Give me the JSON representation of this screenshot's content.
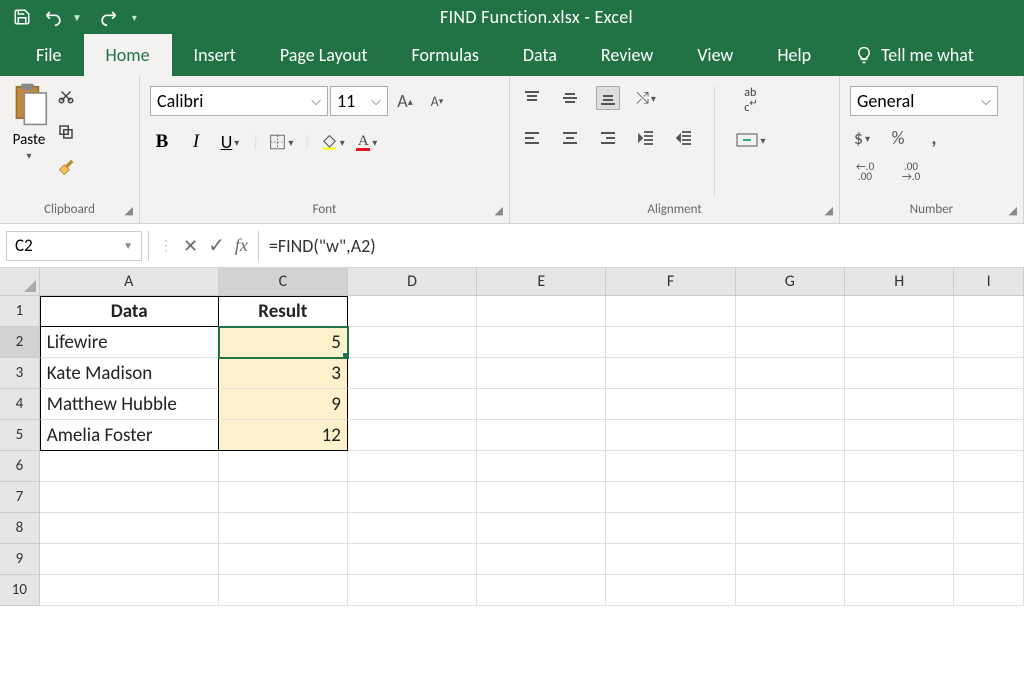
{
  "titlebar": {
    "title": "FIND Function.xlsx  -  Excel"
  },
  "tabs": {
    "file": "File",
    "home": "Home",
    "insert": "Insert",
    "pagelayout": "Page Layout",
    "formulas": "Formulas",
    "data": "Data",
    "review": "Review",
    "view": "View",
    "help": "Help",
    "tellme": "Tell me what"
  },
  "ribbon": {
    "clipboard": {
      "paste": "Paste",
      "label": "Clipboard"
    },
    "font": {
      "name": "Calibri",
      "size": "11",
      "label": "Font",
      "bold": "B",
      "italic": "I",
      "underline": "U",
      "growA": "A",
      "shrinkA": "A"
    },
    "alignment": {
      "label": "Alignment",
      "wrap": "ab",
      "wrap2": "c"
    },
    "number": {
      "format": "General",
      "label": "Number",
      "curr": "$",
      "pct": "%",
      "comma": ",",
      "incdec_l": ".0",
      "incdec_l2": ".00",
      "incdec_r": ".00",
      "incdec_r2": ".0"
    }
  },
  "formula": {
    "namebox": "C2",
    "fx": "fx",
    "formula": "=FIND(\"w\",A2)"
  },
  "cols": {
    "A": "A",
    "B": "",
    "C": "C",
    "D": "D",
    "E": "E",
    "F": "F",
    "G": "G",
    "H": "H",
    "I": "I"
  },
  "colW": {
    "A": 180,
    "C": 130,
    "D": 130,
    "E": 130,
    "F": 130,
    "G": 110,
    "H": 110,
    "I": 60
  },
  "rows": {
    "1": {
      "A": "Data",
      "C": "Result"
    },
    "2": {
      "A": "Lifewire",
      "C": "5"
    },
    "3": {
      "A": "Kate Madison",
      "C": "3"
    },
    "4": {
      "A": "Matthew Hubble",
      "C": "9"
    },
    "5": {
      "A": "Amelia Foster",
      "C": "12"
    },
    "6": {},
    "7": {},
    "8": {},
    "9": {},
    "10": {}
  }
}
